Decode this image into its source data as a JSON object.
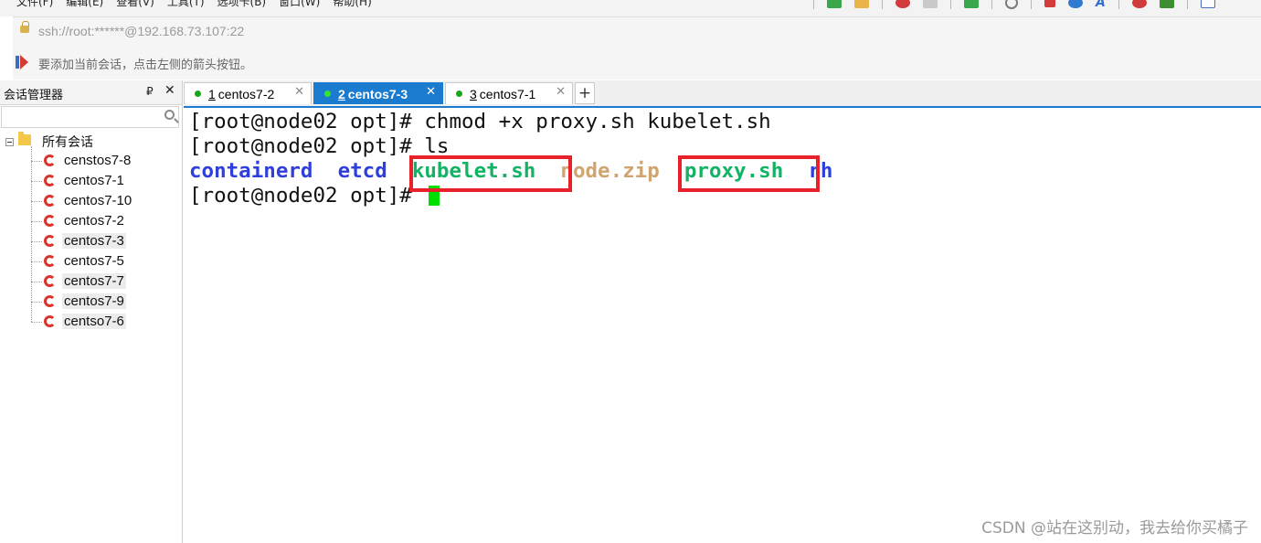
{
  "menubar": {
    "items": [
      "文件(F)",
      "编辑(E)",
      "查看(V)",
      "工具(T)",
      "选项卡(B)",
      "窗口(W)",
      "帮助(H)"
    ]
  },
  "address": {
    "url": "ssh://root:******@192.168.73.107:22"
  },
  "hint": {
    "text": "要添加当前会话，点击左侧的箭头按钮。"
  },
  "session_panel": {
    "title": "会话管理器",
    "pin_glyph": "₽",
    "close_glyph": "✕",
    "search_value": "",
    "root_label": "所有会话",
    "items": [
      {
        "label": "censtos7-8",
        "highlighted": false
      },
      {
        "label": "centos7-1",
        "highlighted": false
      },
      {
        "label": "centos7-10",
        "highlighted": false
      },
      {
        "label": "centos7-2",
        "highlighted": false
      },
      {
        "label": "centos7-3",
        "highlighted": true
      },
      {
        "label": "centos7-5",
        "highlighted": false
      },
      {
        "label": "centos7-7",
        "highlighted": true
      },
      {
        "label": "centos7-9",
        "highlighted": true
      },
      {
        "label": "centso7-6",
        "highlighted": true
      }
    ]
  },
  "tabs": [
    {
      "num": "1",
      "name": "centos7-2",
      "active": false
    },
    {
      "num": "2",
      "name": "centos7-3",
      "active": true
    },
    {
      "num": "3",
      "name": "centos7-1",
      "active": false
    }
  ],
  "tab_close_glyph": "✕",
  "tab_add_glyph": "+",
  "terminal": {
    "line1": "[root@node02 opt]# chmod +x proxy.sh kubelet.sh",
    "line2": "[root@node02 opt]# ls",
    "ls_output": {
      "containerd": "containerd",
      "etcd": "etcd",
      "kubelet": "kubelet.sh",
      "node_zip": "node.zip",
      "proxy": "proxy.sh",
      "rh": "rh"
    },
    "prompt": "[root@node02 opt]# "
  },
  "watermark": "CSDN @站在这别动，我去给你买橘子",
  "colors": {
    "accent_tab": "#1a7bcf",
    "directory": "#2f3fdc",
    "executable": "#12b364",
    "archive": "#cfa46f",
    "cursor": "#00e000",
    "highlight_box": "#e8212a",
    "session_icon": "#d9332a"
  },
  "icons": {
    "address": "lock-icon",
    "hint": "arrow-icon",
    "search": "search-icon",
    "tree_root": "folder-icon",
    "session": "swirl-session-icon"
  }
}
